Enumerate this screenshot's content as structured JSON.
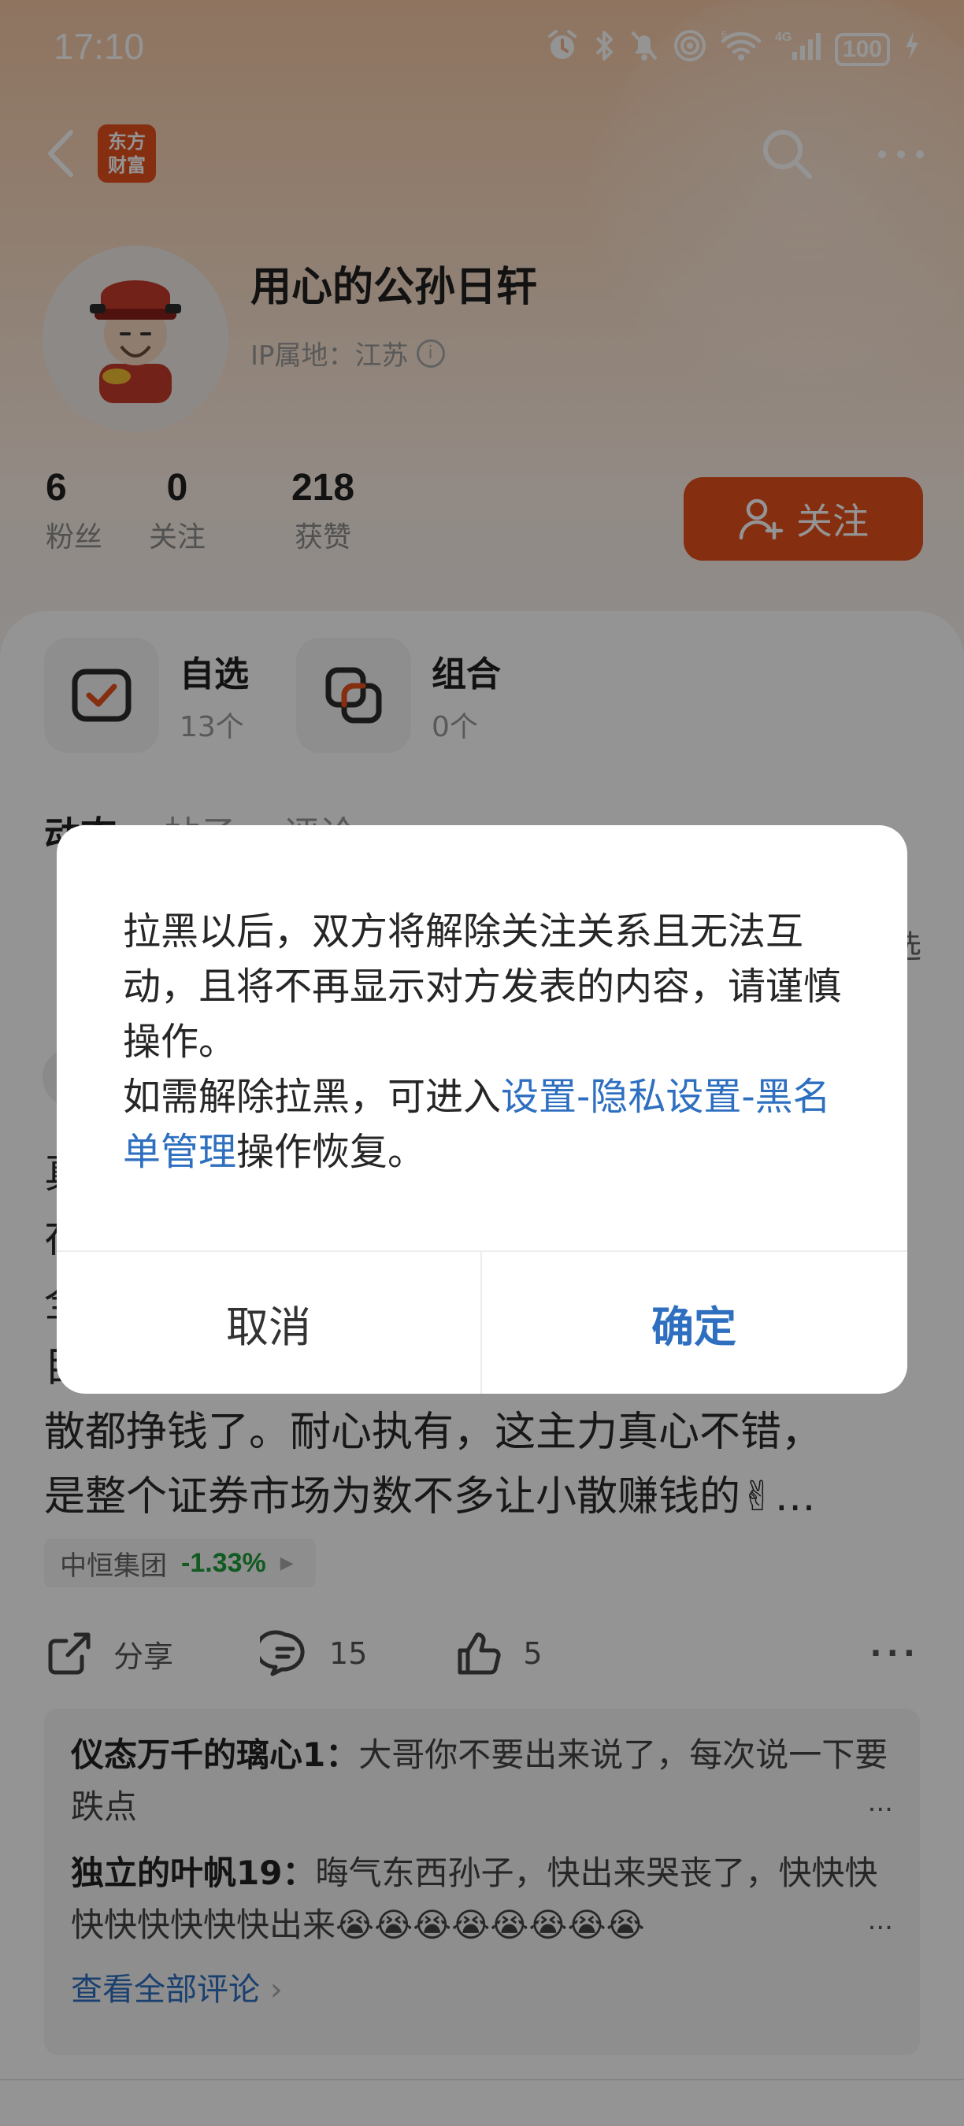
{
  "status_bar": {
    "time": "17:10",
    "battery": "100",
    "icons": [
      "alarm-icon",
      "bluetooth-icon",
      "mute-icon",
      "hotspot-icon",
      "wifi-icon",
      "4g-signal-icon",
      "charging-icon"
    ],
    "network": "4G",
    "wifi_badge": "6"
  },
  "header": {
    "logo_text_line1": "东方",
    "logo_text_line2": "财富",
    "accent_color": "#e5501c"
  },
  "profile": {
    "name": "用心的公孙日轩",
    "ip_location": "IP属地：江苏",
    "stats": [
      {
        "value": "6",
        "label": "粉丝"
      },
      {
        "value": "0",
        "label": "关注"
      },
      {
        "value": "218",
        "label": "获赞"
      }
    ],
    "follow_label": "关注"
  },
  "quick_links": [
    {
      "title": "自选",
      "sub": "13个"
    },
    {
      "title": "组合",
      "sub": "0个"
    }
  ],
  "tabs": [
    "动态",
    "帖子",
    "评论"
  ],
  "filter_label": "选",
  "post": {
    "text_visible": "真…在…全…目…散都挣钱了。耐心执有，这主力真心不错，是整个证券市场为数不多让小散赚钱的✌…",
    "lines": [
      "真",
      "在",
      "全",
      "目",
      "散都挣钱了。耐心执有，这主力真心不错，",
      "是整个证券市场为数不多让小散赚钱的✌…"
    ],
    "stock": {
      "name": "中恒集团",
      "change": "-1.33%"
    },
    "actions": {
      "share": "分享",
      "comments": "15",
      "likes": "5",
      "more": "···"
    }
  },
  "comments": [
    {
      "user": "仪态万千的璃心1：",
      "text": "大哥你不要出来说了，每次说一下要跌点",
      "more": "..."
    },
    {
      "user": "独立的叶帆19：",
      "text": "晦气东西孙子，快出来哭丧了，快快快快快快快快快出来😭😭😭😭😭😭😭😭",
      "more": "..."
    }
  ],
  "view_all_comments": "查看全部评论",
  "dialog": {
    "message_part1": "拉黑以后，双方将解除关注关系且无法互动，且将不再显示对方发表的内容，请谨慎操作。",
    "message_part2_prefix": "如需解除拉黑，可进入",
    "message_link": "设置-隐私设置-黑名单管理",
    "message_part2_suffix": "操作恢复。",
    "cancel_label": "取消",
    "confirm_label": "确定",
    "link_color": "#2e6fc0"
  }
}
